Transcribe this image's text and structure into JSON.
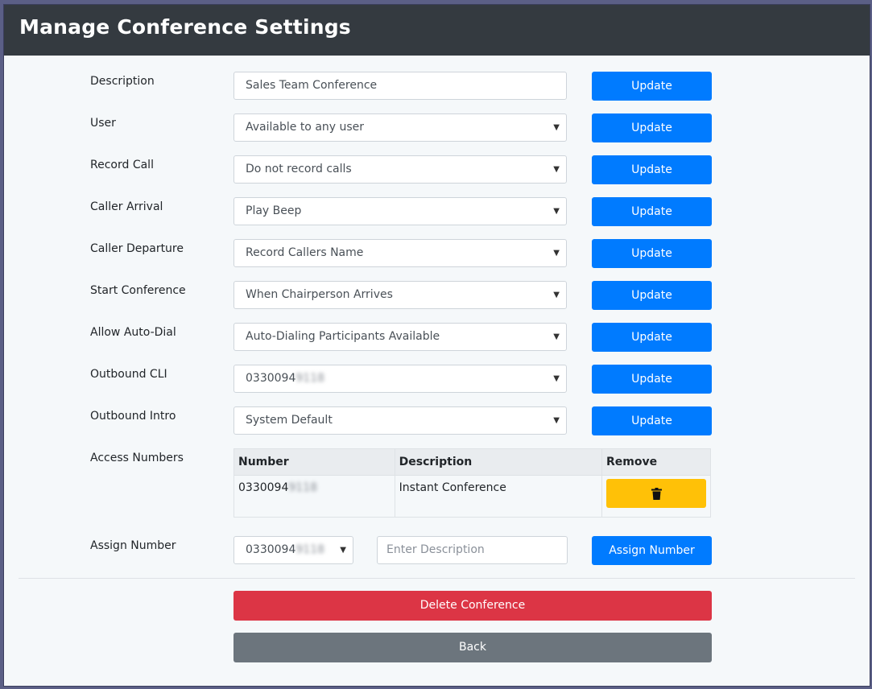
{
  "header": {
    "title": "Manage Conference Settings"
  },
  "settings": [
    {
      "label": "Description",
      "value": "Sales Team Conference",
      "kind": "input",
      "button": "Update"
    },
    {
      "label": "User",
      "value": "Available to any user",
      "kind": "select",
      "button": "Update"
    },
    {
      "label": "Record Call",
      "value": "Do not record calls",
      "kind": "select",
      "button": "Update"
    },
    {
      "label": "Caller Arrival",
      "value": "Play Beep",
      "kind": "select",
      "button": "Update"
    },
    {
      "label": "Caller Departure",
      "value": "Record Callers Name",
      "kind": "select",
      "button": "Update"
    },
    {
      "label": "Start Conference",
      "value": "When Chairperson Arrives",
      "kind": "select",
      "button": "Update"
    },
    {
      "label": "Allow Auto-Dial",
      "value": "Auto-Dialing Participants Available",
      "kind": "select",
      "button": "Update"
    },
    {
      "label": "Outbound CLI",
      "value": "0330094",
      "value_blurred": "9118",
      "kind": "select",
      "button": "Update"
    },
    {
      "label": "Outbound Intro",
      "value": "System Default",
      "kind": "select",
      "button": "Update"
    }
  ],
  "access_numbers": {
    "label": "Access Numbers",
    "columns": [
      "Number",
      "Description",
      "Remove"
    ],
    "rows": [
      {
        "number": "0330094",
        "number_blurred": "9118",
        "description": "Instant Conference"
      }
    ]
  },
  "assign": {
    "label": "Assign Number",
    "selected_number": "0330094",
    "selected_number_blurred": "9118",
    "description_placeholder": "Enter Description",
    "button": "Assign Number"
  },
  "actions": {
    "delete": "Delete Conference",
    "back": "Back"
  },
  "colors": {
    "header_bg": "#343a40",
    "primary": "#007bff",
    "warning": "#ffc107",
    "danger": "#dc3545",
    "secondary": "#6c757d"
  },
  "icons": {
    "remove": "trash-icon",
    "select_caret": "caret-down-icon"
  }
}
